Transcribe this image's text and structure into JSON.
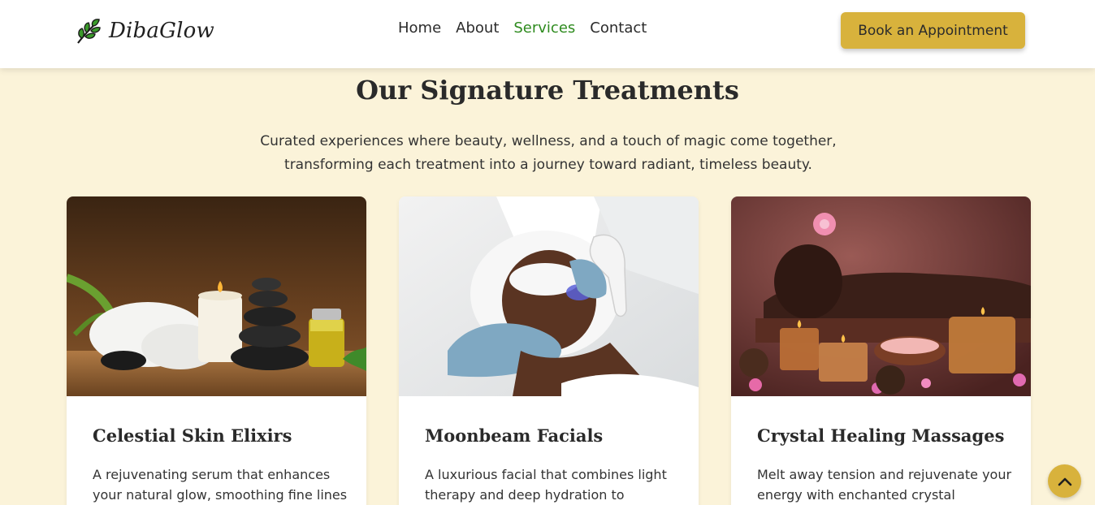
{
  "header": {
    "logo_text": "DibaGlow",
    "nav": [
      "Home",
      "About",
      "Services",
      "Contact"
    ],
    "active_nav": "Services",
    "cta_label": "Book an Appointment"
  },
  "section": {
    "title": "Our Signature Treatments",
    "subtitle": "Curated experiences where beauty, wellness, and a touch of magic come together, transforming each treatment into a journey toward radiant, timeless beauty."
  },
  "cards": [
    {
      "title": "Celestial Skin Elixirs",
      "description": "A rejuvenating serum that enhances your natural glow, smoothing fine lines"
    },
    {
      "title": "Moonbeam Facials",
      "description": "A luxurious facial that combines light therapy and deep hydration to"
    },
    {
      "title": "Crystal Healing Massages",
      "description": "Melt away tension and rejuvenate your energy with enchanted crystal"
    }
  ],
  "icons": {
    "logo": "leaf-icon",
    "scroll_top": "chevron-up-icon"
  },
  "colors": {
    "background": "#fbf3d9",
    "accent_gold": "#d8b23c",
    "active_green": "#2e8b1e"
  }
}
